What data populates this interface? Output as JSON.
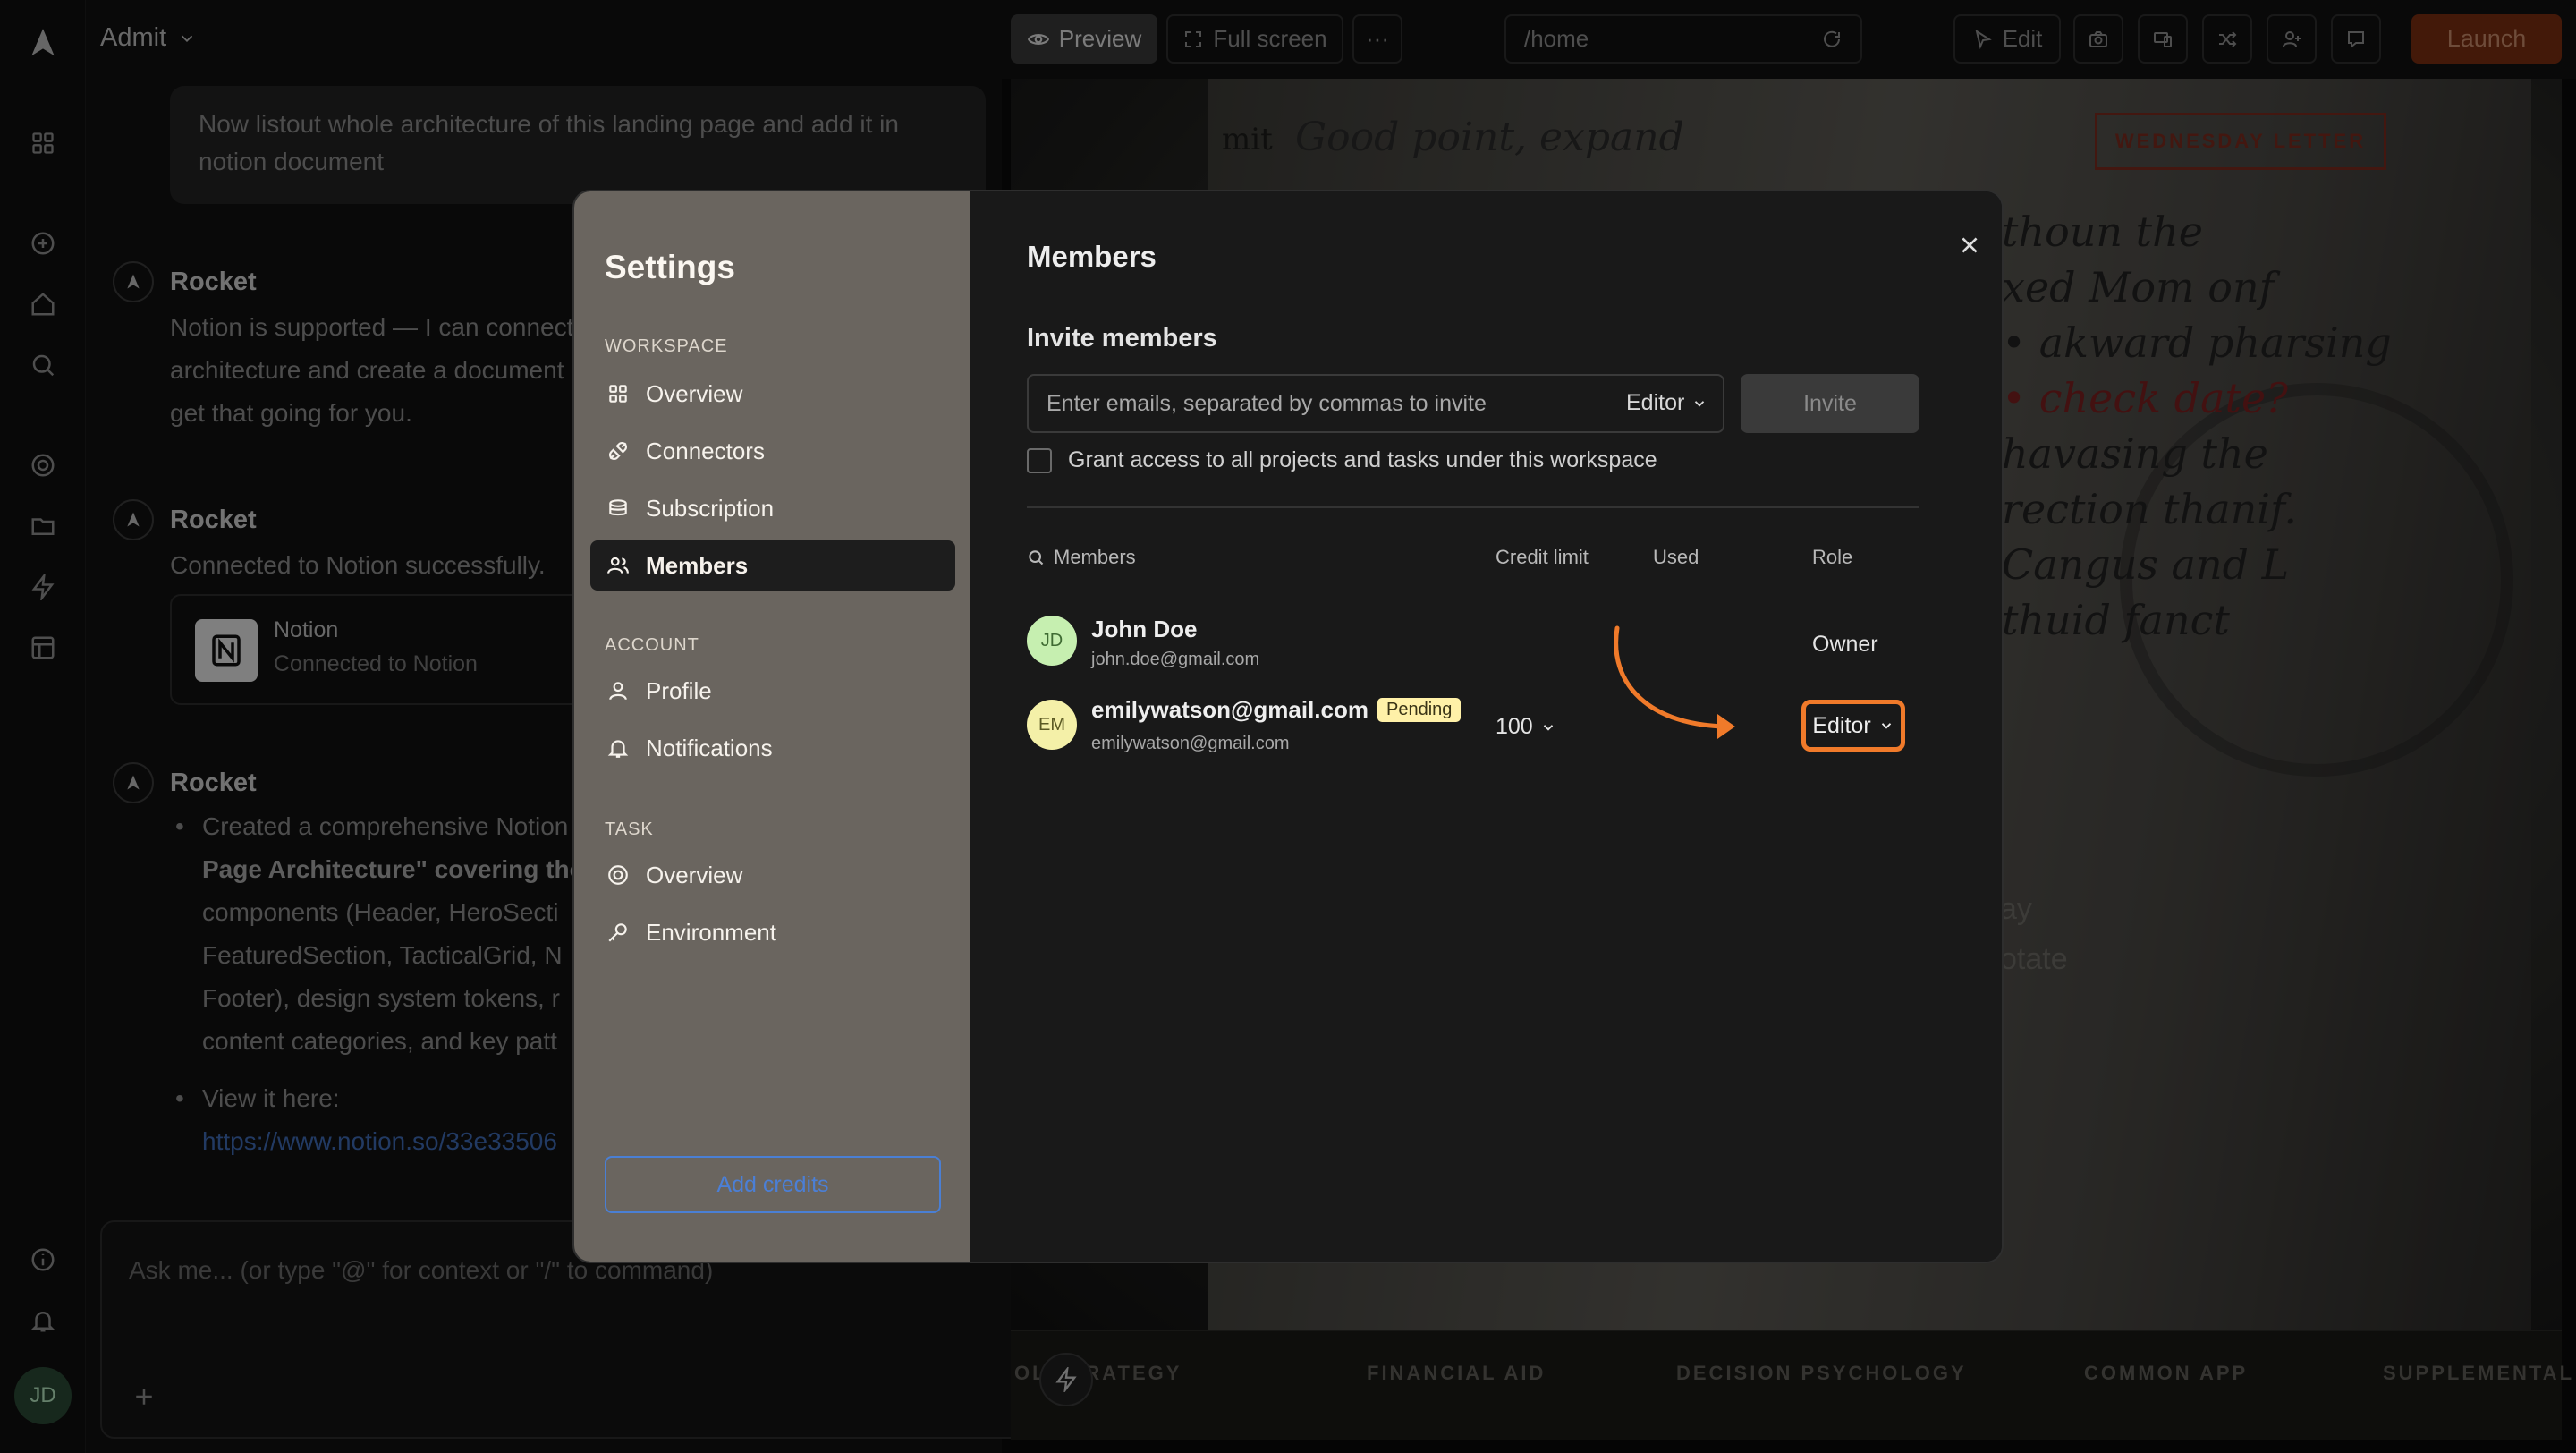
{
  "app": {
    "title": "Admit",
    "user_initials": "JD"
  },
  "chat": {
    "user_message": "Now listout whole architecture of this landing page and add it in notion document",
    "messages": [
      {
        "author": "Rocket",
        "text": "Notion is supported — I can connect",
        "text2": "architecture and create a document",
        "text3": "get that going for you."
      },
      {
        "author": "Rocket",
        "text": "Connected to Notion successfully."
      },
      {
        "author": "Rocket",
        "bullet1_lines": [
          "Created a comprehensive Notion",
          "Page Architecture\" covering the",
          "components (Header, HeroSecti",
          "FeaturedSection, TacticalGrid, N",
          "Footer), design system tokens, r",
          "content categories, and key patt"
        ],
        "bullet2": "View it here:",
        "link": "https://www.notion.so/33e33506"
      }
    ],
    "notion_card": {
      "title": "Notion",
      "subtitle": "Connected to Notion"
    },
    "composer_placeholder": "Ask me... (or type \"@\" for context or \"/\" to command)"
  },
  "toolbar": {
    "preview": "Preview",
    "fullscreen": "Full screen",
    "more": "···",
    "url": "/home",
    "edit": "Edit",
    "launch": "Launch"
  },
  "preview": {
    "handwriting_1": "Good point, expand",
    "brand_fragment": "mit",
    "newsletter_btn": "WEDNESDAY LETTER",
    "handwriting_lines": [
      "thoun the",
      "xed Mom onf",
      "• akward pharsing",
      "• check date?",
      "havasing the",
      "rection thanif.",
      "Cangus and L",
      "thuid fanct"
    ],
    "faded_1": "ay",
    "faded_2": "otate",
    "strip_labels": [
      "OL STRATEGY",
      "FINANCIAL AID",
      "DECISION PSYCHOLOGY",
      "COMMON APP",
      "SUPPLEMENTAL"
    ]
  },
  "settings": {
    "title": "Settings",
    "workspace_label": "WORKSPACE",
    "workspace_items": [
      "Overview",
      "Connectors",
      "Subscription",
      "Members"
    ],
    "account_label": "ACCOUNT",
    "account_items": [
      "Profile",
      "Notifications"
    ],
    "task_label": "TASK",
    "task_items": [
      "Overview",
      "Environment"
    ],
    "add_credits": "Add credits"
  },
  "members": {
    "title": "Members",
    "invite_title": "Invite members",
    "invite_placeholder": "Enter emails, separated by commas to invite",
    "invite_role": "Editor",
    "invite_button": "Invite",
    "grant_access": "Grant access to all projects and tasks under this workspace",
    "columns": {
      "members": "Members",
      "credit_limit": "Credit limit",
      "used": "Used",
      "role": "Role"
    },
    "rows": [
      {
        "initials": "JD",
        "name": "John Doe",
        "email": "john.doe@gmail.com",
        "credit": "",
        "used": "",
        "role": "Owner"
      },
      {
        "initials": "EM",
        "name": "emilywatson@gmail.com",
        "email": "emilywatson@gmail.com",
        "badge": "Pending",
        "credit": "100",
        "used": "-",
        "role": "Editor"
      }
    ]
  },
  "colors": {
    "accent": "#f07a2a",
    "launch_bg": "#7a2e12",
    "link": "#4b7fd6",
    "avatar_bg": "#c6efb0",
    "badge_bg": "#fff1a8"
  }
}
